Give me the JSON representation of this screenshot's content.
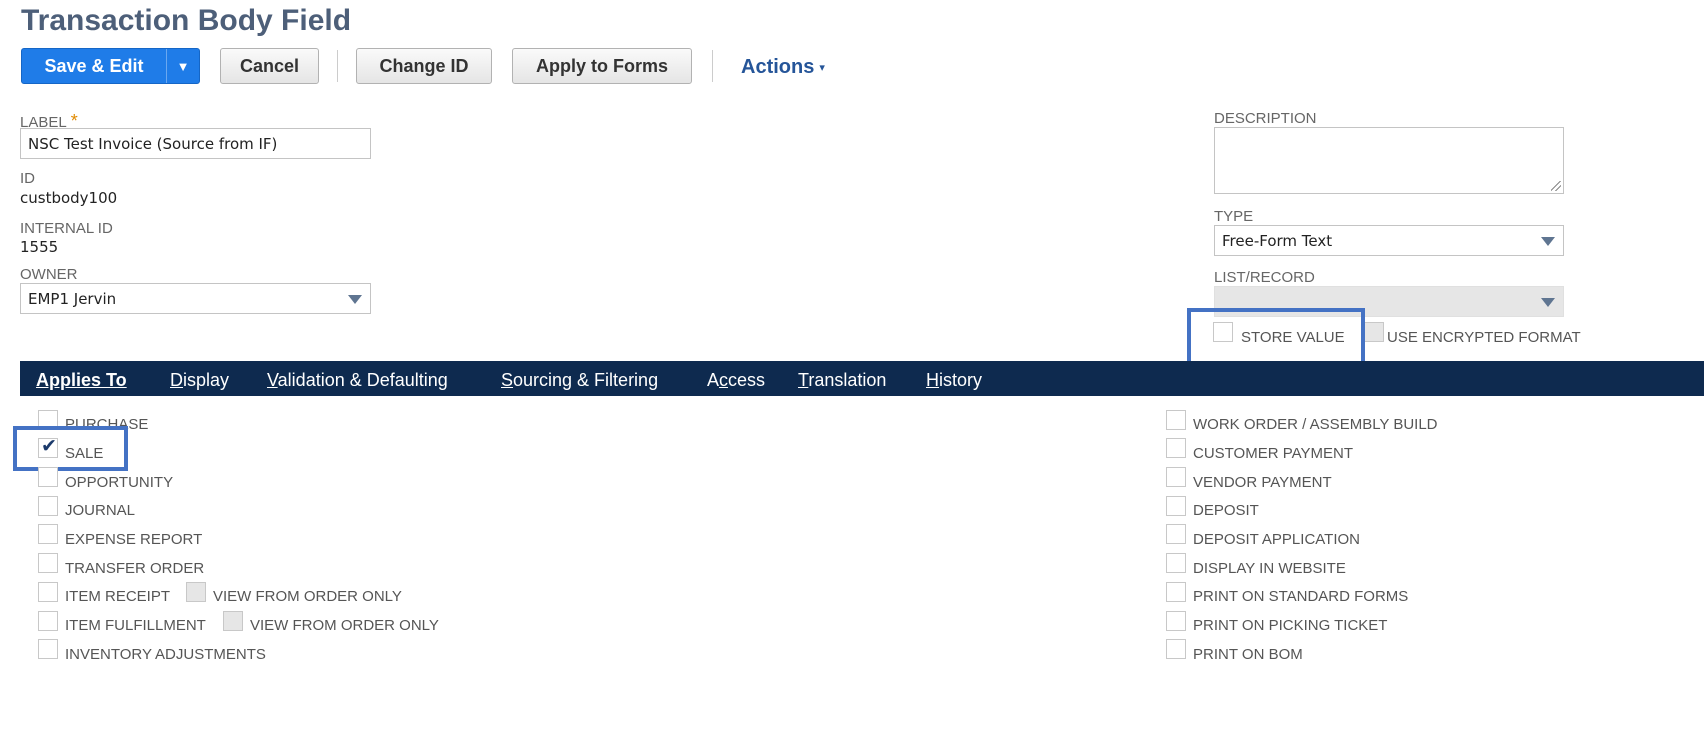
{
  "page": {
    "title": "Transaction Body Field"
  },
  "toolbar": {
    "save_edit": "Save & Edit",
    "save_drop": "▼",
    "cancel": "Cancel",
    "change_id": "Change ID",
    "apply_to_forms": "Apply to Forms",
    "actions": "Actions",
    "actions_caret": "▾"
  },
  "fields": {
    "label_label": "Label",
    "label_required": "*",
    "label_value": "NSC Test Invoice (Source from IF)",
    "id_label": "ID",
    "id_value": "custbody100",
    "internal_id_label": "Internal ID",
    "internal_id_value": "1555",
    "owner_label": "Owner",
    "owner_value": "EMP1 Jervin",
    "description_label": "Description",
    "description_value": "",
    "type_label": "Type",
    "type_value": "Free-Form Text",
    "list_record_label": "List/Record",
    "list_record_value": "",
    "store_value_label": "Store Value",
    "store_value_checked": false,
    "use_encrypted_label": "Use Encrypted Format",
    "use_encrypted_checked": false
  },
  "tabs": {
    "applies_to": "Applies To",
    "display_first": "D",
    "display_rest": "isplay",
    "validation_first": "V",
    "validation_rest": "alidation & Defaulting",
    "sourcing_first": "S",
    "sourcing_rest": "ourcing & Filtering",
    "access_pre": "A",
    "access_u": "c",
    "access_rest": "cess",
    "translation_first": "T",
    "translation_rest": "ranslation",
    "history_first": "H",
    "history_rest": "istory"
  },
  "applies_left": {
    "purchase": "Purchase",
    "sale": "Sale",
    "opportunity": "Opportunity",
    "journal": "Journal",
    "expense_report": "Expense Report",
    "transfer_order": "Transfer Order",
    "item_receipt": "Item Receipt",
    "item_receipt_view": "View from Order Only",
    "item_fulfillment": "Item Fulfillment",
    "item_fulfillment_view": "View from Order Only",
    "inventory_adjustments": "Inventory Adjustments"
  },
  "applies_right": {
    "work_order": "Work Order / Assembly Build",
    "customer_payment": "Customer Payment",
    "vendor_payment": "Vendor Payment",
    "deposit": "Deposit",
    "deposit_application": "Deposit Application",
    "display_in_website": "Display in Website",
    "print_standard_forms": "Print on Standard Forms",
    "print_picking_ticket": "Print on Picking Ticket",
    "print_bom": "Print on BOM"
  },
  "checked": {
    "sale": true
  },
  "colors": {
    "primary": "#1f7ce8",
    "tabbar": "#0e2a4f",
    "title": "#4d5f79",
    "highlight": "#4472c4",
    "link": "#255599"
  }
}
